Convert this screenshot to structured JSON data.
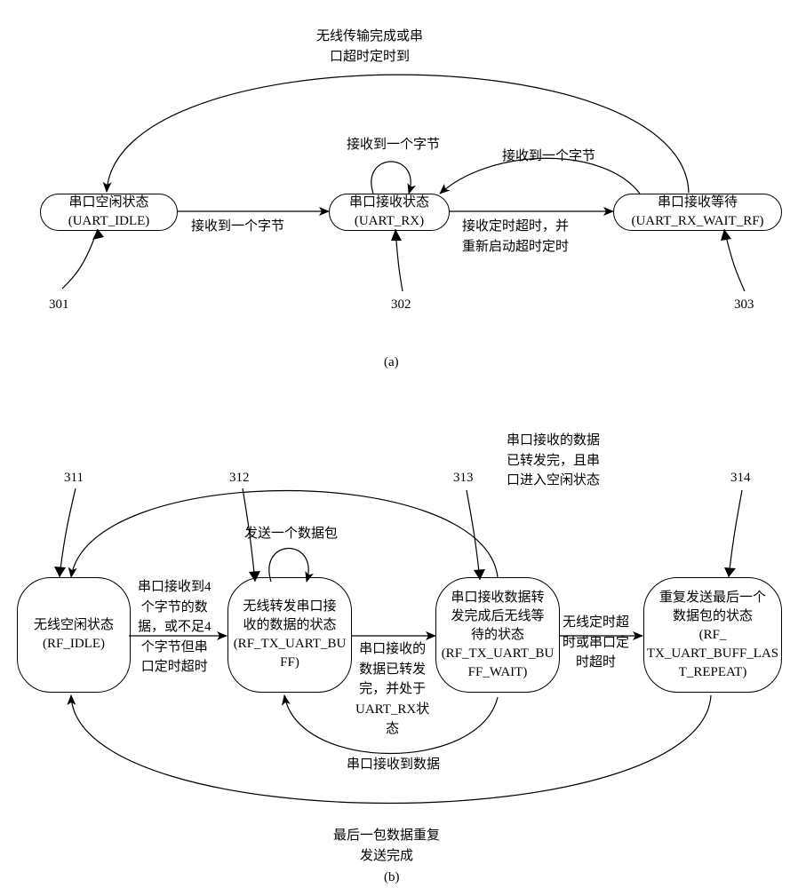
{
  "diagram_a": {
    "label": "(a)",
    "states": {
      "uart_idle": {
        "line1": "串口空闲状态",
        "line2": "(UART_IDLE)"
      },
      "uart_rx": {
        "line1": "串口接收状态",
        "line2": "(UART_RX)"
      },
      "uart_rx_wait": {
        "line1": "串口接收等待",
        "line2": "(UART_RX_WAIT_RF)"
      }
    },
    "transitions": {
      "idle_to_rx": "接收到一个字节",
      "rx_loop": "接收到一个字节",
      "rx_to_wait": "接收定时超时，并\n重新启动超时定时",
      "wait_to_rx": "接收到一个字节",
      "wait_to_idle": "无线传输完成或串\n口超时定时到"
    },
    "refs": {
      "r301": "301",
      "r302": "302",
      "r303": "303"
    }
  },
  "diagram_b": {
    "label": "(b)",
    "states": {
      "rf_idle": {
        "line1": "无线空闲状态",
        "line2": "(RF_IDLE)"
      },
      "rf_tx_buff": {
        "line1": "无线转发串口接",
        "line2": "收的数据的状态",
        "line3": "(RF_TX_UART_BU",
        "line4": "FF)"
      },
      "rf_tx_wait": {
        "line1": "串口接收数据转",
        "line2": "发完成后无线等",
        "line3": "待的状态",
        "line4": "(RF_TX_UART_BU",
        "line5": "FF_WAIT)"
      },
      "rf_repeat": {
        "line1": "重复发送最后一个",
        "line2": "数据包的状态",
        "line3": "(RF_",
        "line4": "TX_UART_BUFF_LAS",
        "line5": "T_REPEAT)"
      }
    },
    "transitions": {
      "idle_to_tx": "串口接收到4\n个字节的数\n据，或不足4\n个字节但串\n口定时超时",
      "tx_loop": "发送一个数据包",
      "tx_to_wait": "串口接收的\n数据已转发\n完，并处于\nUART_RX状\n态",
      "wait_to_repeat": "无线定时超\n时或串口定\n时超时",
      "wait_to_idle_top": "串口接收的数据\n已转发完，且串\n口进入空闲状态",
      "wait_to_tx_bottom": "串口接收到数据",
      "repeat_to_idle": "最后一包数据重复\n发送完成"
    },
    "refs": {
      "r311": "311",
      "r312": "312",
      "r313": "313",
      "r314": "314"
    }
  }
}
